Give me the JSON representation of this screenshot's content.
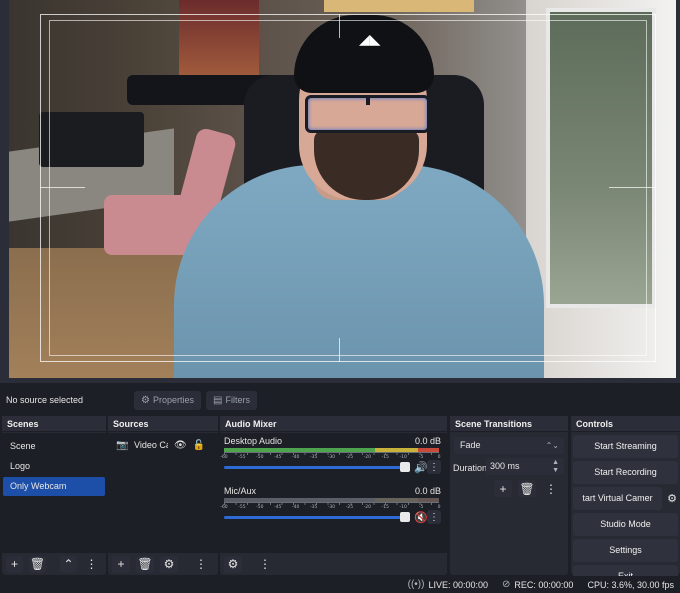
{
  "context_bar": {
    "selection_text": "No source selected",
    "properties_label": "Properties",
    "filters_label": "Filters"
  },
  "scenes": {
    "title": "Scenes",
    "items": [
      {
        "label": "Scene",
        "selected": false
      },
      {
        "label": "Logo",
        "selected": false
      },
      {
        "label": "Only Webcam",
        "selected": true
      }
    ]
  },
  "sources": {
    "title": "Sources",
    "items": [
      {
        "label": "Video Cap",
        "icon": "camera-icon"
      }
    ]
  },
  "audio_mixer": {
    "title": "Audio Mixer",
    "tick_labels": [
      "-60",
      "-55",
      "-50",
      "-45",
      "-40",
      "-35",
      "-30",
      "-25",
      "-20",
      "-15",
      "-10",
      "-5",
      "0"
    ],
    "channels": [
      {
        "name": "Desktop Audio",
        "level": "0.0 dB",
        "volume": 1.0,
        "muted": false
      },
      {
        "name": "Mic/Aux",
        "level": "0.0 dB",
        "volume": 1.0,
        "muted": true
      }
    ]
  },
  "scene_transitions": {
    "title": "Scene Transitions",
    "transition": "Fade",
    "duration_label": "Duration",
    "duration_value": "300 ms"
  },
  "controls": {
    "title": "Controls",
    "start_streaming": "Start Streaming",
    "start_recording": "Start Recording",
    "virtual_camera": "tart Virtual Camer",
    "studio_mode": "Studio Mode",
    "settings": "Settings",
    "exit": "Exit"
  },
  "status_bar": {
    "live": "LIVE: 00:00:00",
    "rec": "REC: 00:00:00",
    "cpu": "CPU: 3.6%, 30.00 fps"
  },
  "colors": {
    "accent": "#1e4fa8",
    "slider": "#2d6ad6",
    "meter_green": "#4ea34e",
    "meter_yellow": "#c9b23a",
    "meter_red": "#c84a3a",
    "muted": "#d83a3a"
  }
}
